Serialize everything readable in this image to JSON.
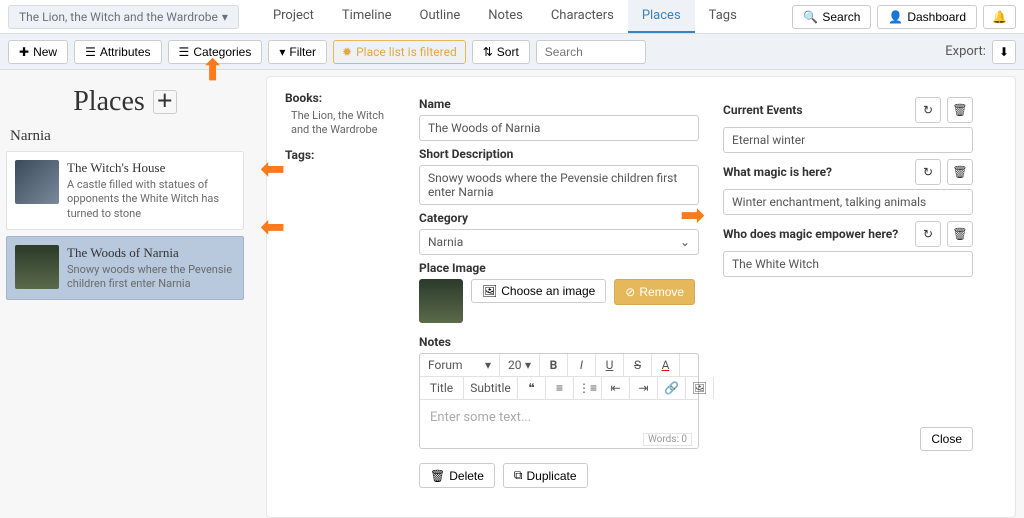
{
  "topbar": {
    "project_name": "The Lion, the Witch and the Wardrobe",
    "nav": [
      "Project",
      "Timeline",
      "Outline",
      "Notes",
      "Characters",
      "Places",
      "Tags"
    ],
    "active_nav": "Places",
    "search_btn": "Search",
    "dashboard_btn": "Dashboard"
  },
  "toolbar": {
    "new_btn": "New",
    "attributes_btn": "Attributes",
    "categories_btn": "Categories",
    "filter_btn": "Filter",
    "filtered_msg": "Place list is filtered",
    "sort_btn": "Sort",
    "search_placeholder": "Search",
    "export_label": "Export:"
  },
  "sidebar": {
    "heading": "Places",
    "category": "Narnia",
    "items": [
      {
        "title": "The Witch's House",
        "desc": "A castle filled with statues of opponents the White Witch has turned to stone"
      },
      {
        "title": "The Woods of Narnia",
        "desc": "Snowy woods where the Pevensie children first enter Narnia"
      }
    ]
  },
  "meta": {
    "books_label": "Books:",
    "book": "The Lion, the Witch and the Wardrobe",
    "tags_label": "Tags:"
  },
  "form": {
    "name_label": "Name",
    "name_value": "The Woods of Narnia",
    "shortdesc_label": "Short Description",
    "shortdesc_value": "Snowy woods where the Pevensie children first enter Narnia",
    "category_label": "Category",
    "category_value": "Narnia",
    "image_label": "Place Image",
    "choose_image": "Choose an image",
    "remove_btn": "Remove",
    "notes_label": "Notes",
    "font_family": "Forum",
    "font_size": "20",
    "title_btn": "Title",
    "subtitle_btn": "Subtitle",
    "notes_placeholder": "Enter some text...",
    "word_count": "Words: 0",
    "delete_btn": "Delete",
    "duplicate_btn": "Duplicate"
  },
  "attrs": {
    "a1_label": "Current Events",
    "a1_value": "Eternal winter",
    "a2_label": "What magic is here?",
    "a2_value": "Winter enchantment, talking animals",
    "a3_label": "Who does magic empower here?",
    "a3_value": "The White Witch",
    "close_btn": "Close"
  }
}
